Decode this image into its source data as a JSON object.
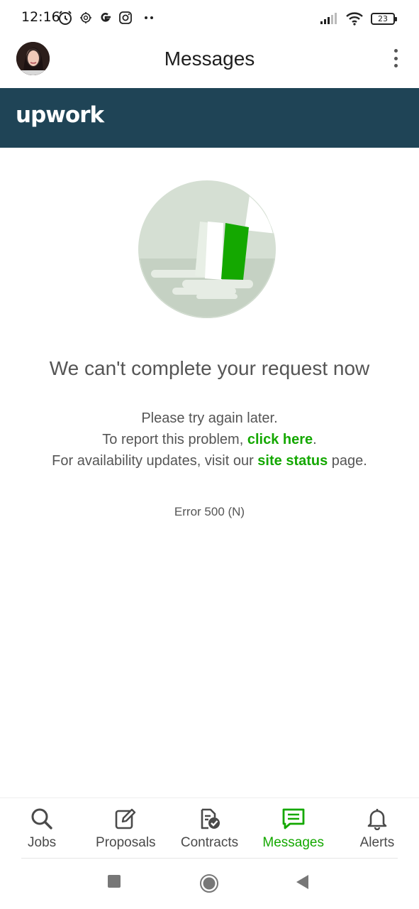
{
  "status_bar": {
    "time": "12:16",
    "left_icons": [
      "alarm-icon",
      "bug-icon",
      "google-icon",
      "instagram-icon",
      "more-notifications-icon"
    ],
    "right_icons": [
      "signal-icon",
      "wifi-icon"
    ],
    "battery": "23"
  },
  "app_bar": {
    "title": "Messages",
    "avatar_icon": "avatar",
    "menu_icon": "more-vert-icon"
  },
  "banner": {
    "logo": "upwork",
    "color": "#1f4456"
  },
  "error": {
    "title": "We can't complete your request now",
    "line1": "Please try again later.",
    "line2_prefix": "To report this problem, ",
    "line2_link": "click here",
    "line2_suffix": ".",
    "line3_prefix": "For availability updates, visit our ",
    "line3_link": "site status",
    "line3_suffix": " page.",
    "code": "Error 500 (N)"
  },
  "bottom_nav": {
    "items": [
      {
        "label": "Jobs",
        "icon": "search-icon",
        "active": false
      },
      {
        "label": "Proposals",
        "icon": "edit-icon",
        "active": false
      },
      {
        "label": "Contracts",
        "icon": "contract-check-icon",
        "active": false
      },
      {
        "label": "Messages",
        "icon": "message-icon",
        "active": true
      },
      {
        "label": "Alerts",
        "icon": "bell-icon",
        "active": false
      }
    ]
  },
  "colors": {
    "accent": "#14a800",
    "text": "#555555",
    "banner": "#1f4456"
  }
}
